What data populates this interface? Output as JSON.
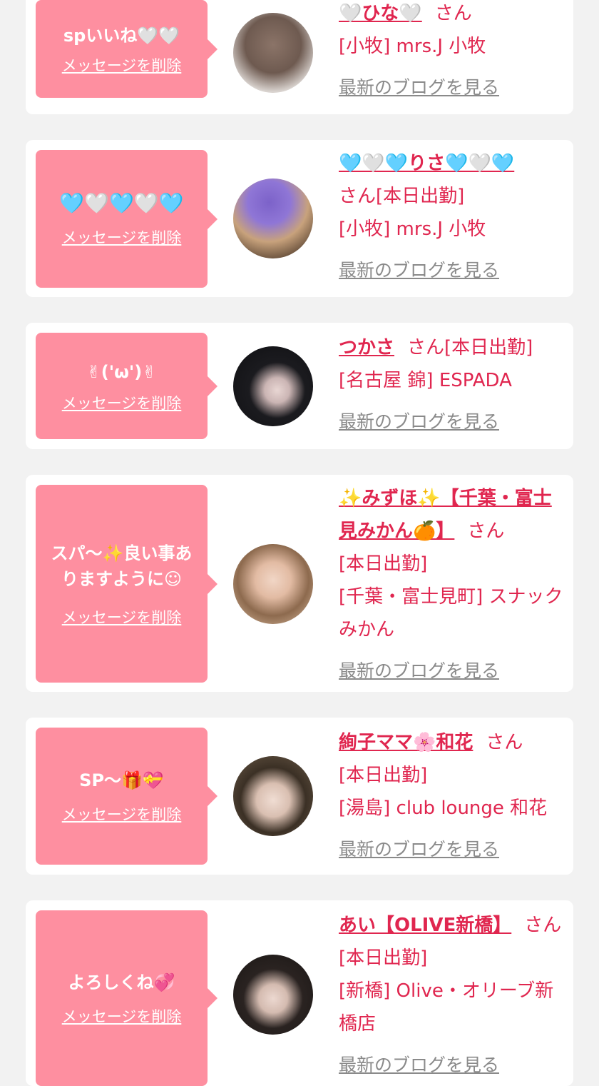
{
  "cards": [
    {
      "message": "spいいね🤍🤍",
      "delete_label": "メッセージを削除",
      "name": "🤍ひな🤍",
      "san": "さん",
      "status": "",
      "shop": "[小牧] mrs.J 小牧",
      "blog_label": "最新のブログを見る",
      "avatar_icon": "woman-long-hair-photo"
    },
    {
      "message": "🩵🤍🩵🤍🩵",
      "delete_label": "メッセージを削除",
      "name": "🩵🤍🩵りさ🩵🤍🩵",
      "san": "さん",
      "status": "[本日出勤]",
      "shop": "[小牧] mrs.J 小牧",
      "blog_label": "最新のブログを見る",
      "avatar_icon": "woman-purple-sticker-photo"
    },
    {
      "message": "✌('ω')✌",
      "delete_label": "メッセージを削除",
      "name": "つかさ",
      "san": "さん",
      "status": "[本日出勤]",
      "shop": "[名古屋 錦] ESPADA",
      "blog_label": "最新のブログを見る",
      "avatar_icon": "woman-peace-sign-photo"
    },
    {
      "message": "スパ〜✨良い事ありますように☺",
      "delete_label": "メッセージを削除",
      "name": "✨みずほ✨【千葉・富士見みかん🍊】",
      "san": "さん",
      "status": "[本日出勤]",
      "shop": "[千葉・富士見町] スナックみかん",
      "blog_label": "最新のブログを見る",
      "avatar_icon": "woman-portrait-photo"
    },
    {
      "message": "SP〜🎁💝",
      "delete_label": "メッセージを削除",
      "name": "絢子ママ🌸和花",
      "san": "さん",
      "status": "[本日出勤]",
      "shop": "[湯島] club lounge 和花",
      "blog_label": "最新のブログを見る",
      "avatar_icon": "woman-lounge-photo"
    },
    {
      "message": "よろしくね💞",
      "delete_label": "メッセージを削除",
      "name": "あい【OLIVE新橋】",
      "san": "さん",
      "status": "[本日出勤]",
      "shop": "[新橋] Olive・オリーブ新橋店",
      "blog_label": "最新のブログを見る",
      "avatar_icon": "woman-dark-hair-photo"
    }
  ],
  "colors": {
    "background": "#f2f2f2",
    "bubble": "#fe8fa0",
    "accent_text": "#e0264f",
    "muted_link": "#8a8a8a"
  }
}
